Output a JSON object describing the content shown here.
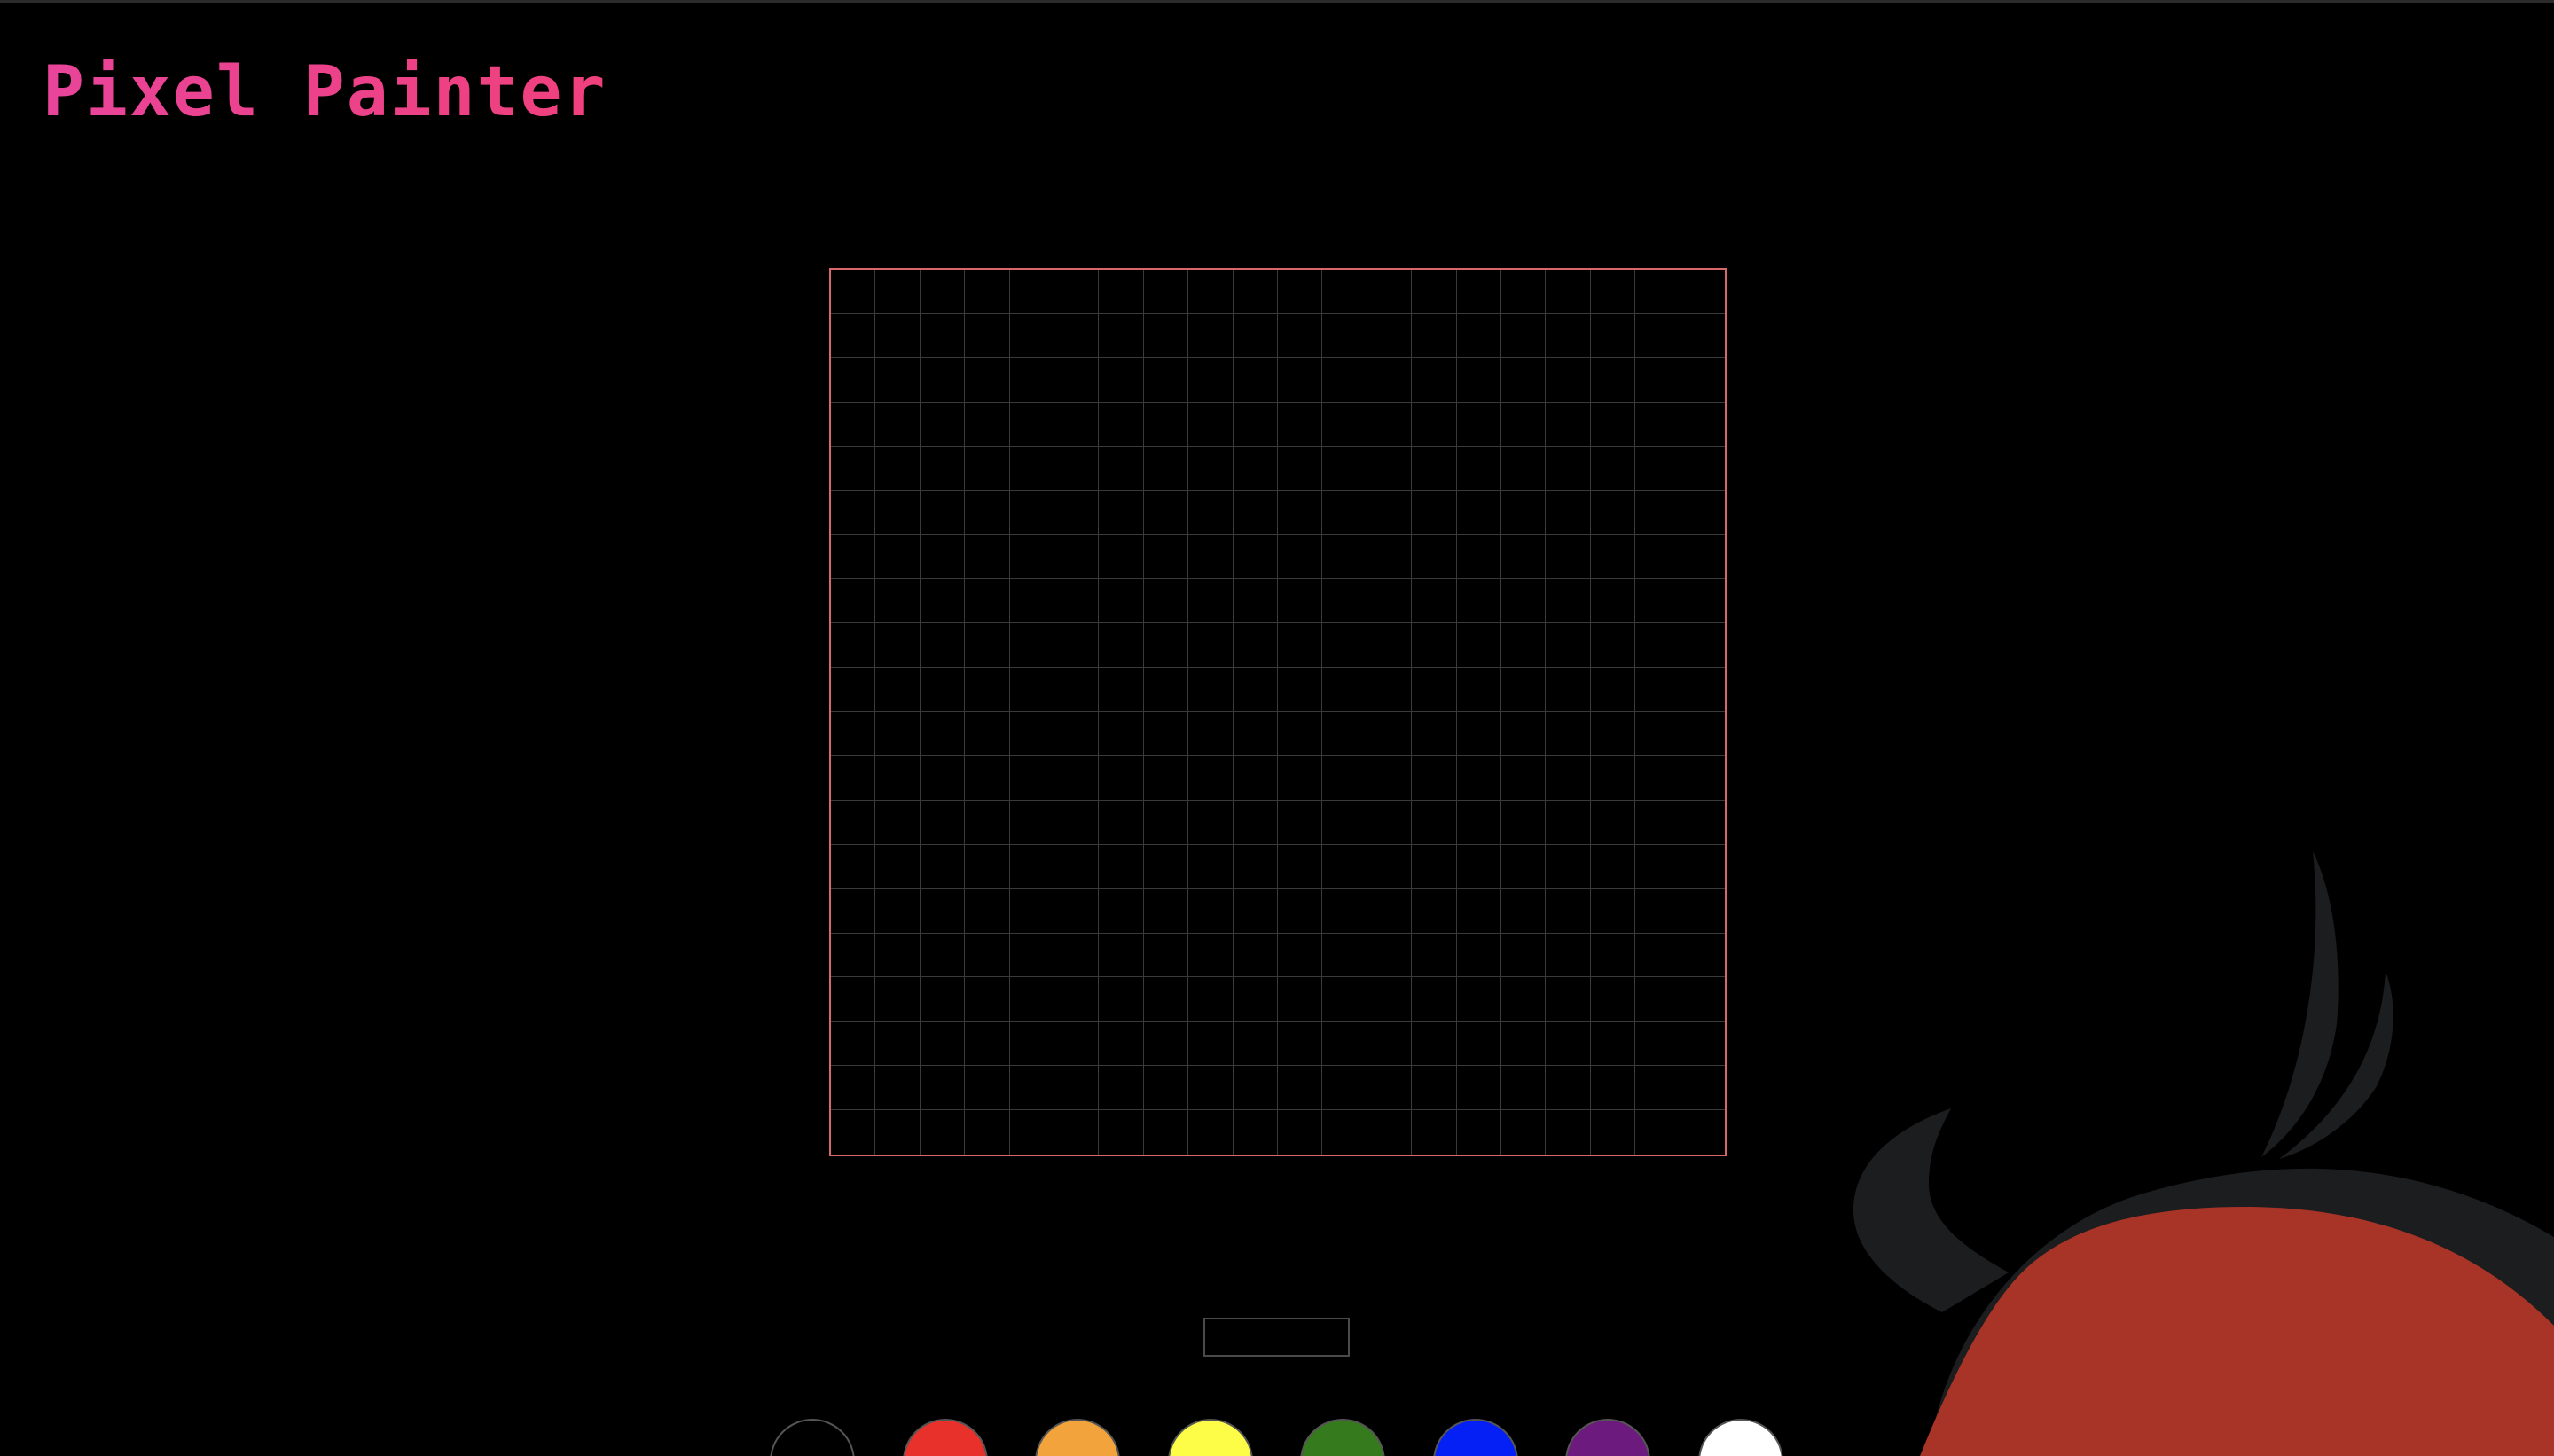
{
  "app": {
    "title": "Pixel Painter"
  },
  "canvas": {
    "columns": 20,
    "rows": 20,
    "border_color": "#d7676b",
    "grid_color": "#3a3a3a"
  },
  "grid_size_input": {
    "value": "",
    "placeholder": ""
  },
  "palette": {
    "colors": [
      {
        "name": "black",
        "hex": "#000000"
      },
      {
        "name": "red",
        "hex": "#e8312a"
      },
      {
        "name": "orange",
        "hex": "#f2a33c"
      },
      {
        "name": "yellow",
        "hex": "#fdfd48"
      },
      {
        "name": "green",
        "hex": "#367a1e"
      },
      {
        "name": "blue",
        "hex": "#0520f5"
      },
      {
        "name": "purple",
        "hex": "#6c1a7d"
      },
      {
        "name": "white",
        "hex": "#ffffff"
      }
    ]
  },
  "mascot": {
    "icon": "devil-head-icon",
    "head_color": "#a83327",
    "horn_color": "#1c1d1f"
  }
}
